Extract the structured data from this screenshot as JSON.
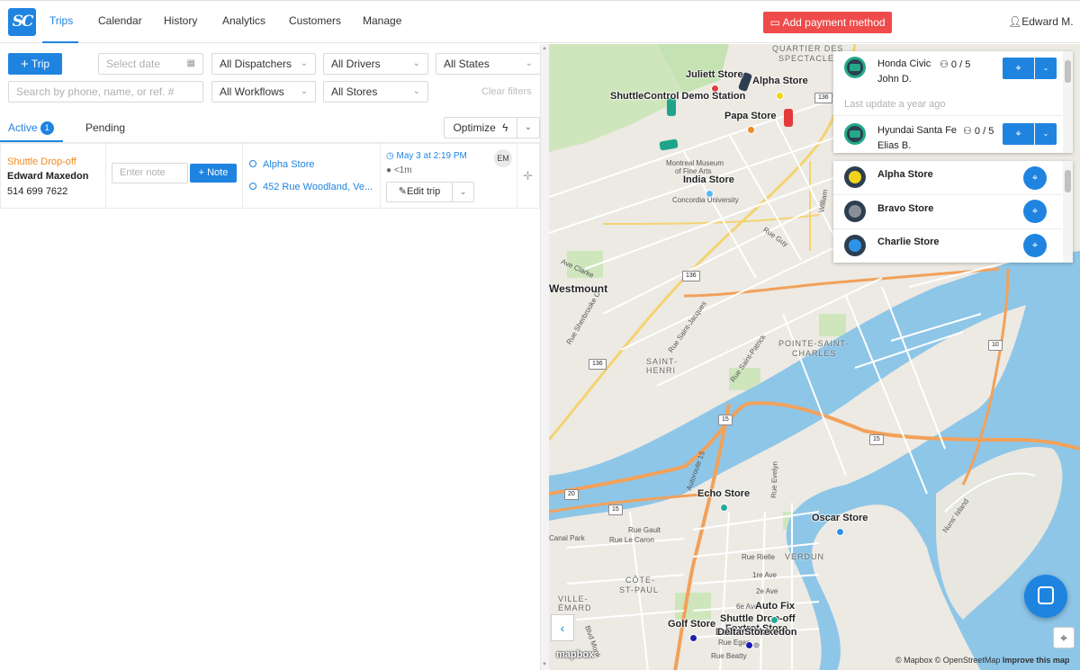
{
  "app": {
    "logo_text": "SC",
    "user": "Edward M.",
    "pay_label": "Add payment method"
  },
  "nav": [
    "Trips",
    "Calendar",
    "History",
    "Analytics",
    "Customers",
    "Manage"
  ],
  "toolbar": {
    "trip_label": "Trip",
    "date_placeholder": "Select date",
    "dispatchers": "All Dispatchers",
    "drivers": "All Drivers",
    "states": "All States",
    "search_placeholder": "Search by phone, name, or ref. #",
    "workflows": "All Workflows",
    "stores": "All Stores",
    "clear": "Clear filters"
  },
  "tabs": {
    "active": "Active",
    "active_count": "1",
    "pending": "Pending",
    "optimize": "Optimize"
  },
  "trip": {
    "type": "Shuttle Drop-off",
    "customer": "Edward Maxedon",
    "phone": "514 699 7622",
    "note_placeholder": "Enter note",
    "note_btn": "Note",
    "pickup": "Alpha Store",
    "dropoff": "452 Rue Woodland, Ve...",
    "when": "May 3 at 2:19 PM",
    "eta": "<1m",
    "initials": "EM",
    "edit_label": "Edit trip"
  },
  "vehicles_panel": {
    "vehicles": [
      {
        "name": "Honda Civic",
        "driver": "John D.",
        "capacity": "0 / 5"
      },
      {
        "name": "Hyundai Santa Fe",
        "driver": "Elias B.",
        "capacity": "0 / 5"
      }
    ],
    "last_update": "Last update a year ago"
  },
  "stores_panel": [
    {
      "name": "Alpha Store",
      "color": "#f2d21b"
    },
    {
      "name": "Bravo Store",
      "color": "#8a8f96"
    },
    {
      "name": "Charlie Store",
      "color": "#2e93e8"
    }
  ],
  "map": {
    "pois": [
      "Juliett Store",
      "Alpha Store",
      "ShuttleControl Demo Station",
      "Papa Store",
      "India Store",
      "Echo Store",
      "Oscar Store",
      "Auto Fix",
      "Shuttle Drop-off",
      "Foxtrot Store",
      "Golf Store",
      "Edward Maxedon",
      "Delta Store",
      "Westmount"
    ],
    "hoods": [
      "QUARTIER DES",
      "SPECTACLES",
      "POINTE-SAINT-",
      "CHARLES",
      "SAINT-",
      "HENRI",
      "VERDUN",
      "CÔTE-",
      "ST-PAUL",
      "VILLE-",
      "ÉMARD"
    ],
    "streets": [
      "Montreal Museum",
      "of Fine Arts",
      "Concordia University",
      "Rue Guy",
      "Ave Clarke",
      "Rue Saint-Jacques",
      "Rue Saint-Patrick",
      "Autoroute 15",
      "Rue Evelyn",
      "Rue Gault",
      "Rue Le Caron",
      "Rue Rielle",
      "1re Ave",
      "2e Ave",
      "6e Ave",
      "Rue Egan",
      "Rue Beatty",
      "Canal Park",
      "Blvd Monk",
      "Nuns' Island",
      "William",
      "Rue Sherbrooke O"
    ],
    "shields": [
      "136",
      "136",
      "136",
      "15",
      "15",
      "15",
      "20",
      "10"
    ],
    "attribution": [
      "© Mapbox",
      "© OpenStreetMap",
      "Improve this map"
    ],
    "brand": "mapbox"
  },
  "icons": [
    "plus-icon",
    "calendar-icon",
    "chevron-down-icon",
    "bolt-icon",
    "clock-icon",
    "pencil-icon",
    "pin-icon",
    "user-icon",
    "chat-icon",
    "locate-icon",
    "drag-icon",
    "chevron-left-icon"
  ]
}
